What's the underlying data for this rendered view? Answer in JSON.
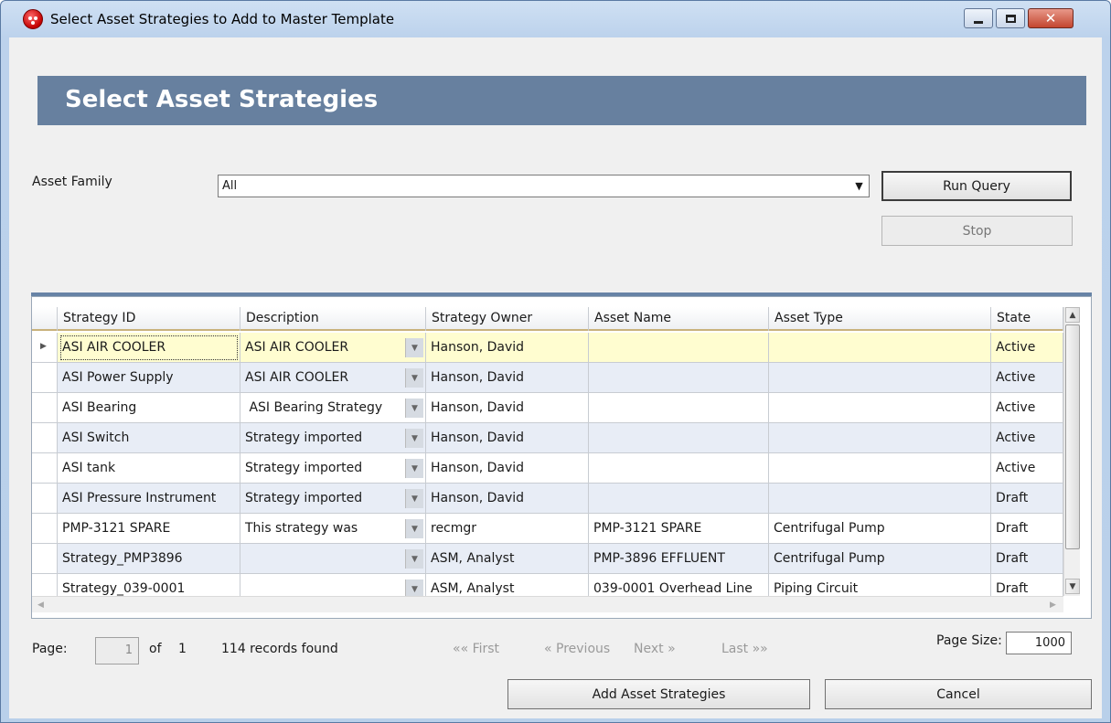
{
  "window": {
    "title": "Select Asset Strategies to Add to Master Template",
    "close_glyph": "✕"
  },
  "banner": {
    "title": "Select Asset Strategies"
  },
  "filter": {
    "asset_family_label": "Asset Family",
    "asset_family_value": "All",
    "run_query_label": "Run Query",
    "stop_label": "Stop"
  },
  "grid": {
    "columns": [
      "Strategy ID",
      "Description",
      "Strategy Owner",
      "Asset Name",
      "Asset Type",
      "State"
    ],
    "rows": [
      [
        "ASI AIR COOLER",
        "ASI AIR COOLER",
        "Hanson, David",
        "",
        "",
        "Active"
      ],
      [
        "ASI Power Supply",
        "ASI AIR COOLER",
        "Hanson, David",
        "",
        "",
        "Active"
      ],
      [
        "ASI Bearing",
        " ASI Bearing Strategy",
        "Hanson, David",
        "",
        "",
        "Active"
      ],
      [
        "ASI Switch",
        "Strategy imported",
        "Hanson, David",
        "",
        "",
        "Active"
      ],
      [
        "ASI tank",
        "Strategy imported",
        "Hanson, David",
        "",
        "",
        "Active"
      ],
      [
        "ASI Pressure Instrument",
        "Strategy imported",
        "Hanson, David",
        "",
        "",
        "Draft"
      ],
      [
        "PMP-3121 SPARE",
        "This strategy was",
        "recmgr",
        "PMP-3121 SPARE",
        "Centrifugal Pump",
        "Draft"
      ],
      [
        "Strategy_PMP3896",
        "",
        "ASM, Analyst",
        "PMP-3896 EFFLUENT",
        "Centrifugal Pump",
        "Draft"
      ],
      [
        "Strategy_039-0001",
        "",
        "ASM, Analyst",
        "039-0001 Overhead Line",
        "Piping Circuit",
        "Draft"
      ]
    ]
  },
  "pager": {
    "page_label": "Page:",
    "current_page": "1",
    "of_label": "of",
    "total_pages": "1",
    "records_text": "114 records found",
    "first": "«« First",
    "previous": "« Previous",
    "next": "Next »",
    "last": "Last »»",
    "page_size_label": "Page Size:",
    "page_size_value": "1000"
  },
  "actions": {
    "add_label": "Add Asset Strategies",
    "cancel_label": "Cancel"
  },
  "colors": {
    "banner": "#67809f",
    "selected_row": "#fffdd0",
    "alt_row": "#e8edf6"
  }
}
